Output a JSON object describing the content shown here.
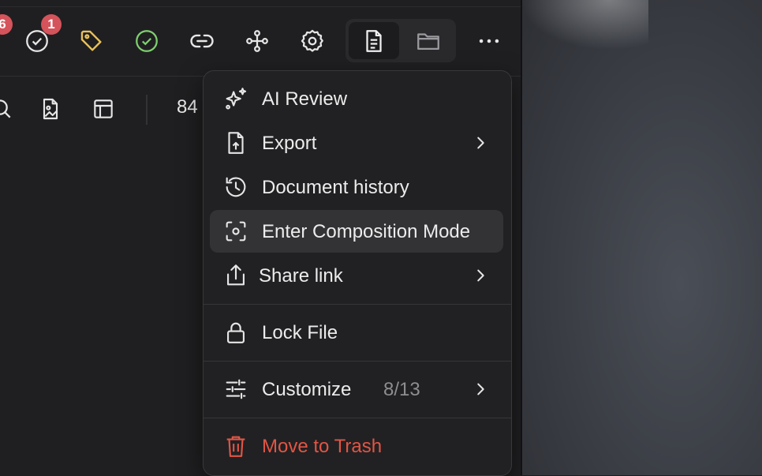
{
  "toolbar": {
    "badges": {
      "left_partial": "6",
      "tasks": "1"
    },
    "icons": [
      "tasks-icon",
      "tag-icon",
      "check-circle-icon",
      "link-icon",
      "graph-icon",
      "settings-icon",
      "document-icon",
      "folder-icon",
      "more-icon"
    ]
  },
  "toolbar2": {
    "zoom_text": "84",
    "icons": [
      "search-icon",
      "image-icon",
      "table-icon"
    ]
  },
  "menu": {
    "items": [
      {
        "label": "AI Review",
        "icon": "sparkles-icon"
      },
      {
        "label": "Export",
        "icon": "file-export-icon",
        "submenu": true
      },
      {
        "label": "Document history",
        "icon": "history-icon"
      },
      {
        "label": "Enter Composition Mode",
        "icon": "focus-icon",
        "highlighted": true
      },
      {
        "label": "Share link",
        "icon": "share-icon",
        "submenu": true
      },
      {
        "label": "Lock File",
        "icon": "lock-icon"
      },
      {
        "label": "Customize",
        "count": "8/13",
        "icon": "sliders-icon",
        "submenu": true
      },
      {
        "label": "Move to Trash",
        "icon": "trash-icon",
        "danger": true
      }
    ]
  },
  "colors": {
    "danger": "#e25545",
    "badge": "#d5535a",
    "tag": "#e8c15a",
    "check": "#7fcf6f"
  }
}
